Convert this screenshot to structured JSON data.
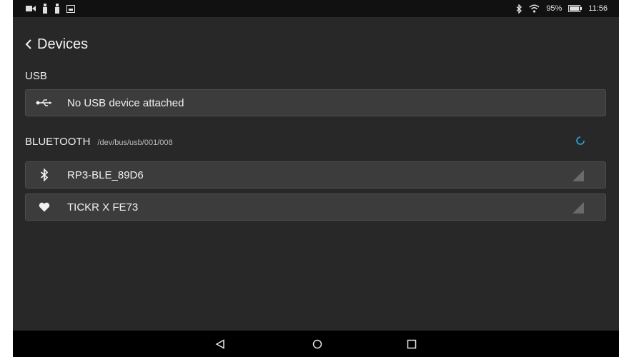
{
  "status_bar": {
    "left_icons": [
      "video-icon",
      "notification-icon",
      "notification-icon",
      "image-icon"
    ],
    "battery_percent": "95%",
    "time": "11:56"
  },
  "header": {
    "title": "Devices"
  },
  "usb": {
    "section_label": "USB",
    "item_label": "No USB device attached"
  },
  "bluetooth": {
    "section_label": "BLUETOOTH",
    "section_path": "/dev/bus/usb/001/008",
    "devices": [
      {
        "label": "RP3-BLE_89D6",
        "icon": "bluetooth-icon"
      },
      {
        "label": "TICKR X FE73",
        "icon": "heart-icon"
      }
    ]
  },
  "colors": {
    "accent": "#29a8e0",
    "background": "#282828",
    "card": "#3c3c3c"
  }
}
